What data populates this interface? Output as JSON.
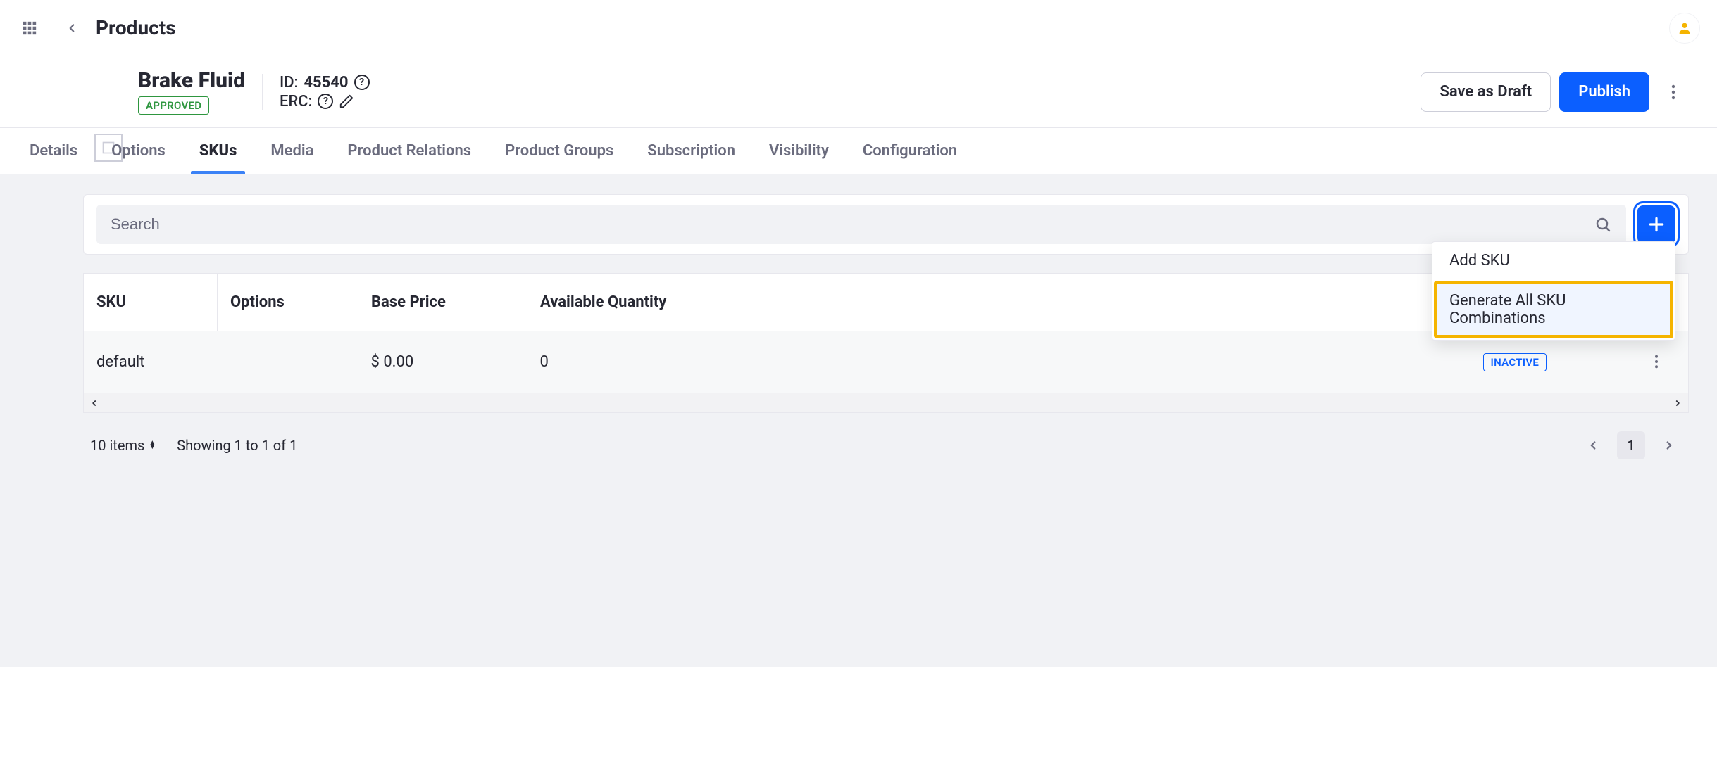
{
  "topbar": {
    "title": "Products"
  },
  "product": {
    "title": "Brake Fluid",
    "status": "APPROVED",
    "id_label": "ID:",
    "id_value": "45540",
    "erc_label": "ERC:"
  },
  "actions": {
    "save_draft": "Save as Draft",
    "publish": "Publish"
  },
  "tabs": [
    "Details",
    "Options",
    "SKUs",
    "Media",
    "Product Relations",
    "Product Groups",
    "Subscription",
    "Visibility",
    "Configuration"
  ],
  "active_tab": 2,
  "search": {
    "placeholder": "Search"
  },
  "dropdown": {
    "add_sku": "Add SKU",
    "generate_all": "Generate All SKU Combinations"
  },
  "table": {
    "headers": [
      "SKU",
      "Options",
      "Base Price",
      "Available Quantity",
      "",
      ""
    ],
    "rows": [
      {
        "sku": "default",
        "options": "",
        "base_price": "$ 0.00",
        "qty": "0",
        "status": "INACTIVE"
      }
    ]
  },
  "pager": {
    "items_per_page": "10 items",
    "showing": "Showing 1 to 1 of 1",
    "current": "1"
  }
}
